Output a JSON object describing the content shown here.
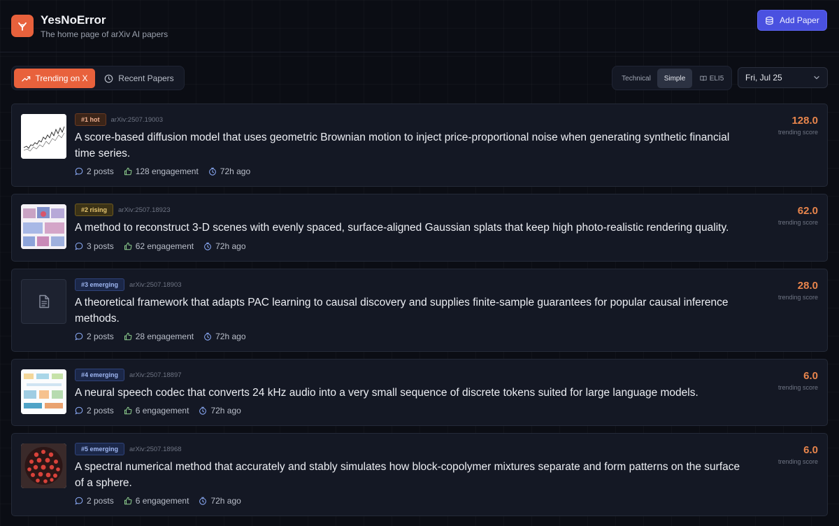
{
  "app": {
    "title": "YesNoError",
    "subtitle": "The home page of arXiv AI papers",
    "add_paper_label": "Add Paper"
  },
  "tabs": {
    "trending": "Trending on X",
    "recent": "Recent Papers"
  },
  "modes": {
    "technical": "Technical",
    "simple": "Simple",
    "eli5": "ELI5",
    "active": "Simple"
  },
  "date_select": {
    "value": "Fri, Jul 25"
  },
  "colors": {
    "accent": "#e8613c",
    "primary_button": "#4a51e0",
    "score": "#e8854c"
  },
  "papers": [
    {
      "badge": "#1 hot",
      "badge_type": "hot",
      "arxiv": "arXiv:2507.19003",
      "title": "A score-based diffusion model that uses geometric Brownian motion to inject price-proportional noise when generating synthetic financial time series.",
      "posts": "2 posts",
      "engagement": "128 engagement",
      "time": "72h ago",
      "score": "128.0",
      "score_label": "trending score",
      "thumb_icon": "price-chart-thumbnail"
    },
    {
      "badge": "#2 rising",
      "badge_type": "rising",
      "arxiv": "arXiv:2507.18923",
      "title": "A method to reconstruct 3-D scenes with evenly spaced, surface-aligned Gaussian splats that keep high photo-realistic rendering quality.",
      "posts": "3 posts",
      "engagement": "62 engagement",
      "time": "72h ago",
      "score": "62.0",
      "score_label": "trending score",
      "thumb_icon": "scene-render-thumbnail"
    },
    {
      "badge": "#3 emerging",
      "badge_type": "emerging",
      "arxiv": "arXiv:2507.18903",
      "title": "A theoretical framework that adapts PAC learning to causal discovery and supplies finite-sample guarantees for popular causal inference methods.",
      "posts": "2 posts",
      "engagement": "28 engagement",
      "time": "72h ago",
      "score": "28.0",
      "score_label": "trending score",
      "thumb_icon": "document-icon"
    },
    {
      "badge": "#4 emerging",
      "badge_type": "emerging",
      "arxiv": "arXiv:2507.18897",
      "title": "A neural speech codec that converts 24 kHz audio into a very small sequence of discrete tokens suited for large language models.",
      "posts": "2 posts",
      "engagement": "6 engagement",
      "time": "72h ago",
      "score": "6.0",
      "score_label": "trending score",
      "thumb_icon": "architecture-diagram-thumbnail"
    },
    {
      "badge": "#5 emerging",
      "badge_type": "emerging",
      "arxiv": "arXiv:2507.18968",
      "title": "A spectral numerical method that accurately and stably simulates how block-copolymer mixtures separate and form patterns on the surface of a sphere.",
      "posts": "2 posts",
      "engagement": "6 engagement",
      "time": "72h ago",
      "score": "6.0",
      "score_label": "trending score",
      "thumb_icon": "sphere-pattern-thumbnail"
    }
  ]
}
